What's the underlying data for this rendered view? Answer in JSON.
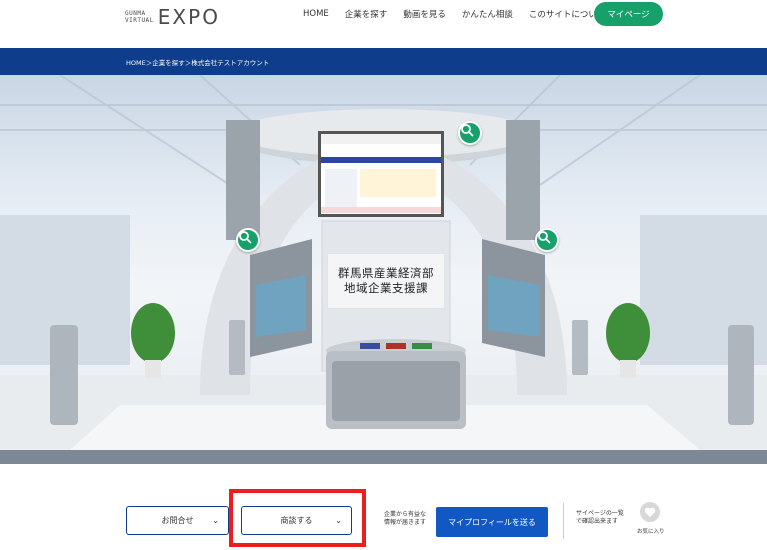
{
  "header": {
    "logo_line1": "GUNMA",
    "logo_line2": "VIRTUAL",
    "logo_main": "EXPO",
    "nav": [
      "HOME",
      "企業を探す",
      "動画を見る",
      "かんたん相談",
      "このサイトについて"
    ],
    "mypage_label": "マイページ"
  },
  "breadcrumb": "HOME＞企業を探す＞株式会社テストアカウント",
  "booth": {
    "sign_line1": "群馬県産業経済部",
    "sign_line2": "地域企業支援課"
  },
  "actions": {
    "inquiry_label": "お問合せ",
    "consult_label": "商談する",
    "note_line1": "企業から有益な",
    "note_line2": "情報が届きます",
    "send_profile_label": "マイプロフィールを送る",
    "mypage_note_line1": "サイページの一覧",
    "mypage_note_line2": "で確認出来ます",
    "favorite_label": "お気に入り"
  },
  "colors": {
    "brand_green": "#18a06a",
    "navy": "#0e3d8c",
    "primary_blue": "#1258c4",
    "highlight_red": "#ee1c1c"
  },
  "icons": {
    "zoom": "search-icon",
    "chevron": "chevron-down-icon",
    "favorite": "heart-icon"
  }
}
